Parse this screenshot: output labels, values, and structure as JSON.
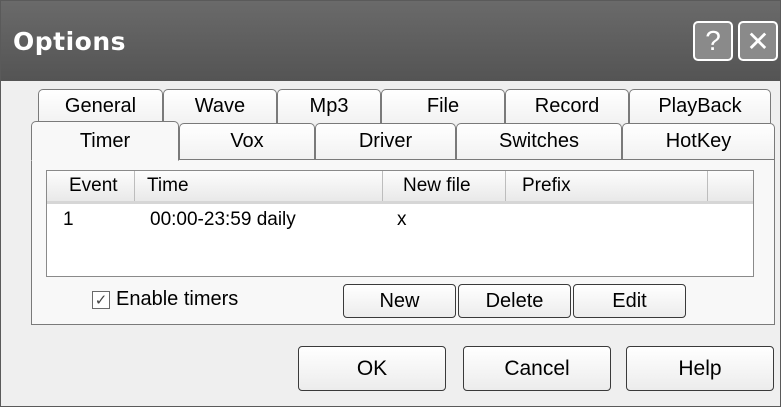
{
  "window": {
    "title": "Options",
    "help_glyph": "?",
    "close_glyph": "✕"
  },
  "tabs_row1": [
    "General",
    "Wave",
    "Mp3",
    "File",
    "Record",
    "PlayBack"
  ],
  "tabs_row2": [
    "Timer",
    "Vox",
    "Driver",
    "Switches",
    "HotKey"
  ],
  "active_tab": "Timer",
  "list": {
    "columns": [
      "Event",
      "Time",
      "New file",
      "Prefix"
    ],
    "rows": [
      {
        "event": "1",
        "time": "00:00-23:59 daily",
        "new_file": "x",
        "prefix": ""
      }
    ]
  },
  "enable_timers": {
    "label": "Enable timers",
    "checked": true,
    "check_glyph": "✓"
  },
  "timer_buttons": {
    "new": "New",
    "delete": "Delete",
    "edit": "Edit"
  },
  "dialog_buttons": {
    "ok": "OK",
    "cancel": "Cancel",
    "help": "Help"
  }
}
